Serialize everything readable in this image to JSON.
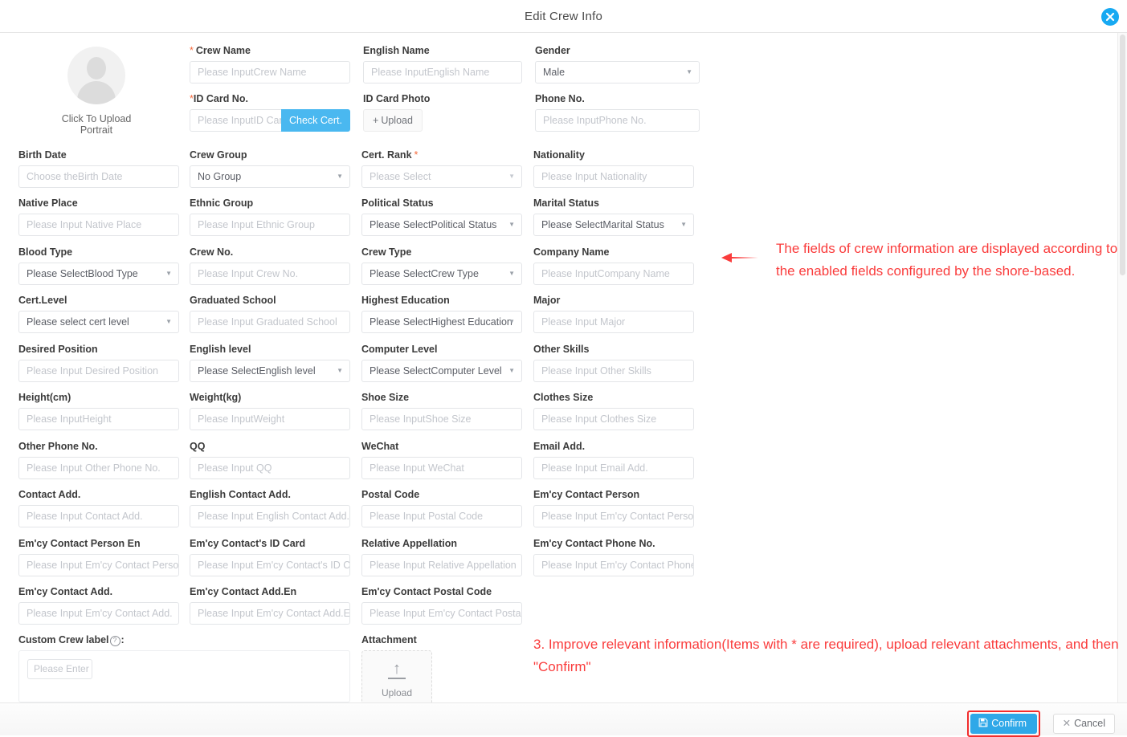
{
  "dialog": {
    "title": "Edit Crew Info",
    "close_icon": "close-icon"
  },
  "avatar": {
    "label": "Click To Upload Portrait",
    "icon": "user-avatar-icon"
  },
  "top_fields": {
    "crew_name": {
      "label": "Crew Name",
      "required": true,
      "placeholder": "Please InputCrew Name"
    },
    "english_name": {
      "label": "English Name",
      "required": false,
      "placeholder": "Please InputEnglish Name"
    },
    "gender": {
      "label": "Gender",
      "required": false,
      "value": "Male"
    },
    "id_card_no": {
      "label": "ID Card No.",
      "required": true,
      "placeholder": "Please InputID Card",
      "button": "Check Cert."
    },
    "id_card_photo": {
      "label": "ID Card Photo",
      "required": false,
      "upload": "Upload"
    },
    "phone_no": {
      "label": "Phone No.",
      "required": false,
      "placeholder": "Please InputPhone No."
    }
  },
  "rows": [
    [
      {
        "label": "Birth Date",
        "placeholder": "Choose theBirth Date",
        "type": "input"
      },
      {
        "label": "Crew Group",
        "value": "No Group",
        "type": "select"
      },
      {
        "label": "Cert. Rank",
        "required": true,
        "placeholder": "Please Select",
        "type": "select-light"
      },
      {
        "label": "Nationality",
        "placeholder": "Please Input Nationality",
        "type": "input"
      }
    ],
    [
      {
        "label": "Native Place",
        "placeholder": "Please Input Native Place",
        "type": "input"
      },
      {
        "label": "Ethnic Group",
        "placeholder": "Please Input Ethnic Group",
        "type": "input"
      },
      {
        "label": "Political Status",
        "value": "Please SelectPolitical Status",
        "type": "select"
      },
      {
        "label": "Marital Status",
        "value": "Please SelectMarital Status",
        "type": "select"
      }
    ],
    [
      {
        "label": "Blood Type",
        "value": "Please SelectBlood Type",
        "type": "select"
      },
      {
        "label": "Crew No.",
        "placeholder": "Please Input Crew No.",
        "type": "input"
      },
      {
        "label": "Crew Type",
        "value": "Please SelectCrew Type",
        "type": "select"
      },
      {
        "label": "Company Name",
        "placeholder": "Please InputCompany Name",
        "type": "input"
      }
    ],
    [
      {
        "label": "Cert.Level",
        "value": "Please select cert level",
        "type": "select"
      },
      {
        "label": "Graduated School",
        "placeholder": "Please Input Graduated School",
        "type": "input"
      },
      {
        "label": "Highest Education",
        "value": "Please SelectHighest Education",
        "type": "select"
      },
      {
        "label": "Major",
        "placeholder": "Please Input Major",
        "type": "input"
      }
    ],
    [
      {
        "label": "Desired Position",
        "placeholder": "Please Input Desired Position",
        "type": "input"
      },
      {
        "label": "English level",
        "value": "Please SelectEnglish level",
        "type": "select"
      },
      {
        "label": "Computer Level",
        "value": "Please SelectComputer Level",
        "type": "select"
      },
      {
        "label": "Other Skills",
        "placeholder": "Please Input Other Skills",
        "type": "input"
      }
    ],
    [
      {
        "label": "Height(cm)",
        "placeholder": "Please InputHeight",
        "type": "input"
      },
      {
        "label": "Weight(kg)",
        "placeholder": "Please InputWeight",
        "type": "input"
      },
      {
        "label": "Shoe Size",
        "placeholder": "Please InputShoe Size",
        "type": "input"
      },
      {
        "label": "Clothes Size",
        "placeholder": "Please Input Clothes Size",
        "type": "input"
      }
    ],
    [
      {
        "label": "Other Phone No.",
        "placeholder": "Please Input Other Phone No.",
        "type": "input"
      },
      {
        "label": "QQ",
        "placeholder": "Please Input QQ",
        "type": "input"
      },
      {
        "label": "WeChat",
        "placeholder": "Please Input WeChat",
        "type": "input"
      },
      {
        "label": "Email Add.",
        "placeholder": "Please Input Email Add.",
        "type": "input"
      }
    ],
    [
      {
        "label": "Contact Add.",
        "placeholder": "Please Input Contact Add.",
        "type": "input"
      },
      {
        "label": "English Contact Add.",
        "placeholder": "Please Input English Contact Add.",
        "type": "input"
      },
      {
        "label": "Postal Code",
        "placeholder": "Please Input Postal Code",
        "type": "input"
      },
      {
        "label": "Em'cy Contact Person",
        "placeholder": "Please Input Em'cy Contact Person",
        "type": "input"
      }
    ],
    [
      {
        "label": "Em'cy Contact Person En",
        "placeholder": "Please Input Em'cy Contact Person",
        "type": "input"
      },
      {
        "label": "Em'cy Contact's ID Card",
        "placeholder": "Please Input Em'cy Contact's ID C",
        "type": "input"
      },
      {
        "label": "Relative Appellation",
        "placeholder": "Please Input Relative Appellation",
        "type": "input"
      },
      {
        "label": "Em'cy Contact Phone No.",
        "placeholder": "Please Input Em'cy Contact Phone",
        "type": "input"
      }
    ],
    [
      {
        "label": "Em'cy Contact Add.",
        "placeholder": "Please Input Em'cy Contact Add.",
        "type": "input"
      },
      {
        "label": "Em'cy Contact Add.En",
        "placeholder": "Please Input Em'cy Contact Add.E",
        "type": "input"
      },
      {
        "label": "Em'cy Contact Postal Code",
        "placeholder": "Please Input Em'cy Contact Postal",
        "type": "input"
      },
      null
    ]
  ],
  "custom_crew_label": {
    "label": "Custom Crew label",
    "suffix": ":",
    "help_icon": "question-mark-icon",
    "placeholder": "Please Enter C"
  },
  "attachment": {
    "label": "Attachment",
    "upload_text": "Upload",
    "icon": "upload-arrow-icon"
  },
  "annotations": {
    "right_note": "The fields of crew information are displayed according to the enabled fields configured by the shore-based.",
    "bottom_note": "3. Improve relevant information(Items with * are required), upload relevant attachments, and then \"Confirm\"",
    "arrow_icon": "arrow-left-icon"
  },
  "footer": {
    "confirm_label": "Confirm",
    "confirm_icon": "save-icon",
    "cancel_label": "Cancel",
    "cancel_icon": "x-icon"
  },
  "colors": {
    "accent": "#2fa8e8",
    "check_cert": "#4ab8f0",
    "annotation_red": "#fa3c3c",
    "required_star": "#f56c3e",
    "highlight_border": "#f22d2d"
  }
}
